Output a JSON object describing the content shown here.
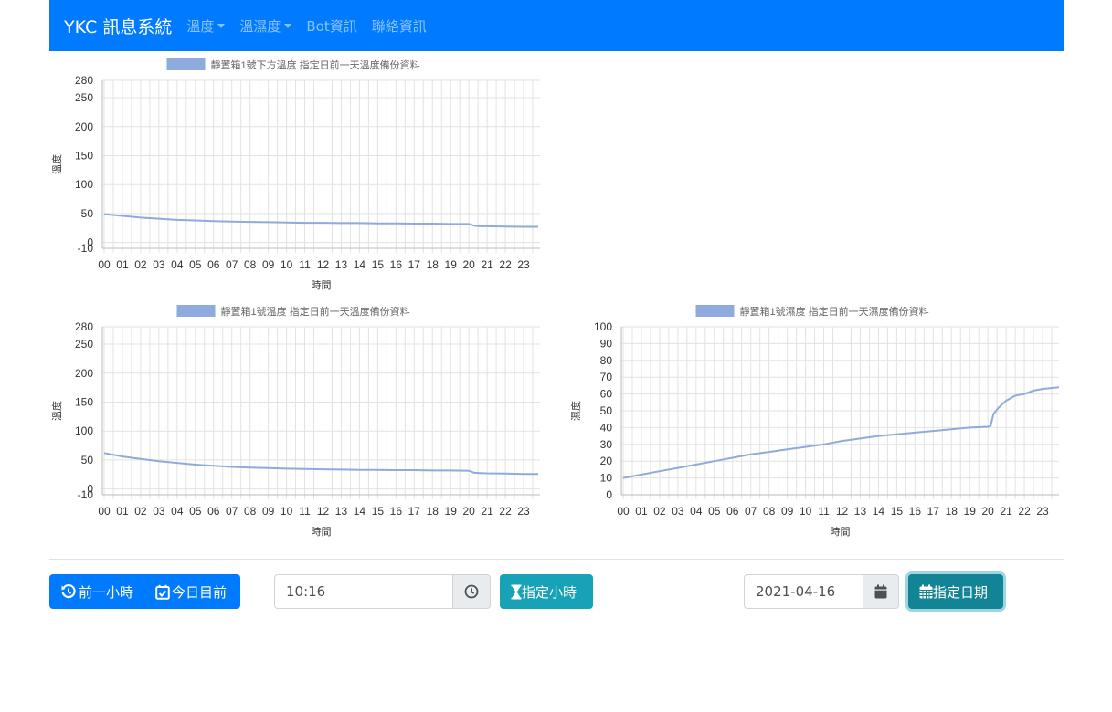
{
  "navbar": {
    "brand": "YKC 訊息系統",
    "items": [
      {
        "label": "溫度",
        "dropdown": true
      },
      {
        "label": "溫濕度",
        "dropdown": true
      },
      {
        "label": "Bot資訊",
        "dropdown": false
      },
      {
        "label": "聯絡資訊",
        "dropdown": false
      }
    ]
  },
  "chart_data": [
    {
      "type": "line",
      "title": "",
      "legend": "靜置箱1號下方溫度 指定日前一天溫度備份資料",
      "xlabel": "時間",
      "ylabel": "溫度",
      "x_ticks": [
        "00",
        "01",
        "02",
        "03",
        "04",
        "05",
        "06",
        "07",
        "08",
        "09",
        "10",
        "11",
        "12",
        "13",
        "14",
        "15",
        "16",
        "17",
        "18",
        "19",
        "20",
        "21",
        "22",
        "23"
      ],
      "y_ticks": [
        -10,
        0,
        50,
        100,
        150,
        200,
        250,
        280
      ],
      "ylim": [
        -10,
        280
      ],
      "grid": true,
      "series": [
        {
          "name": "靜置箱1號下方溫度 指定日前一天溫度備份資料",
          "color": "#8faadc",
          "x": [
            0,
            1,
            2,
            3,
            4,
            5,
            6,
            7,
            8,
            9,
            10,
            11,
            12,
            13,
            14,
            15,
            16,
            17,
            18,
            19,
            20,
            20.3,
            20.6,
            21,
            22,
            23,
            23.8
          ],
          "y": [
            49,
            46,
            43,
            41,
            39,
            38,
            37,
            36,
            35.5,
            35,
            34.5,
            34,
            34,
            33.5,
            33.5,
            33,
            33,
            32.5,
            32.5,
            32,
            32,
            29,
            28,
            28,
            27.5,
            27,
            27
          ]
        }
      ]
    },
    {
      "type": "line",
      "title": "",
      "legend": "靜置箱1號溫度 指定日前一天溫度備份資料",
      "xlabel": "時間",
      "ylabel": "溫度",
      "x_ticks": [
        "00",
        "01",
        "02",
        "03",
        "04",
        "05",
        "06",
        "07",
        "08",
        "09",
        "10",
        "11",
        "12",
        "13",
        "14",
        "15",
        "16",
        "17",
        "18",
        "19",
        "20",
        "21",
        "22",
        "23"
      ],
      "y_ticks": [
        -10,
        0,
        50,
        100,
        150,
        200,
        250,
        280
      ],
      "ylim": [
        -10,
        280
      ],
      "grid": true,
      "series": [
        {
          "name": "靜置箱1號溫度 指定日前一天溫度備份資料",
          "color": "#8faadc",
          "x": [
            0,
            1,
            2,
            3,
            4,
            5,
            6,
            7,
            8,
            9,
            10,
            11,
            12,
            13,
            14,
            15,
            16,
            17,
            18,
            19,
            20,
            20.3,
            20.6,
            21,
            22,
            23,
            23.8
          ],
          "y": [
            62,
            56,
            52,
            48,
            45,
            42,
            40,
            38,
            37,
            36,
            35,
            34.5,
            34,
            33.5,
            33,
            33,
            32.5,
            32.5,
            32,
            32,
            31.5,
            28,
            27.5,
            27,
            26.5,
            26,
            26
          ]
        }
      ]
    },
    {
      "type": "line",
      "title": "",
      "legend": "靜置箱1號濕度 指定日前一天濕度備份資料",
      "xlabel": "時間",
      "ylabel": "濕度",
      "x_ticks": [
        "00",
        "01",
        "02",
        "03",
        "04",
        "05",
        "06",
        "07",
        "08",
        "09",
        "10",
        "11",
        "12",
        "13",
        "14",
        "15",
        "16",
        "17",
        "18",
        "19",
        "20",
        "21",
        "22",
        "23"
      ],
      "y_ticks": [
        0,
        10,
        20,
        30,
        40,
        50,
        60,
        70,
        80,
        90,
        100
      ],
      "ylim": [
        0,
        100
      ],
      "grid": true,
      "series": [
        {
          "name": "靜置箱1號濕度 指定日前一天濕度備份資料",
          "color": "#8faadc",
          "x": [
            0,
            1,
            2,
            3,
            4,
            5,
            6,
            7,
            8,
            9,
            10,
            11,
            12,
            13,
            14,
            15,
            16,
            17,
            18,
            19,
            20,
            20.15,
            20.3,
            20.6,
            21,
            21.5,
            22,
            22.5,
            23,
            23.9
          ],
          "y": [
            10,
            12,
            14,
            16,
            18,
            20,
            22,
            24,
            25.5,
            27,
            28.5,
            30,
            32,
            33.5,
            35,
            36,
            37,
            38,
            39,
            40,
            40.5,
            41,
            48,
            52,
            56,
            59,
            60,
            62,
            63,
            64
          ]
        }
      ]
    }
  ],
  "controls": {
    "prev_hour_label": "前一小時",
    "today_label": "今日目前",
    "time_value": "10:16",
    "set_hour_label": "指定小時",
    "date_value": "2021-04-16",
    "set_date_label": "指定日期"
  },
  "icons": {
    "prev_hour": "history-icon",
    "today": "calendar-check-icon",
    "time": "clock-icon",
    "set_hour": "hourglass-icon",
    "date": "calendar-icon",
    "set_date": "calendar-grid-icon"
  },
  "colors": {
    "navbar": "#007bff",
    "primary_button": "#007bff",
    "info_button": "#17a2b8",
    "series_line": "#8faadc"
  }
}
